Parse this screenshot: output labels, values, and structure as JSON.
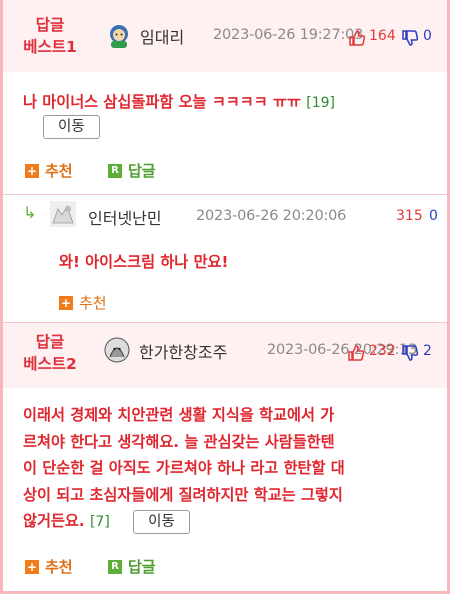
{
  "comments": [
    {
      "badge": "답글\n베스트1",
      "badge_line1": "답글",
      "badge_line2": "베스트1",
      "author": "임대리",
      "date": "2023-06-26 19:27:03",
      "upvotes": "164",
      "downvotes": "0",
      "text": "나 마이너스 삼십돌파함 오늘 ㅋㅋㅋㅋ ㅠㅠ",
      "reply_count": "[19]",
      "move_label": "이동",
      "recommend_label": "추천",
      "reply_label": "답글"
    },
    {
      "author": "인터넷난민",
      "date": "2023-06-26 20:20:06",
      "upvotes": "315",
      "downvotes": "0",
      "text": "와! 아이스크림 하나 만요!",
      "recommend_label": "추천"
    },
    {
      "badge_line1": "답글",
      "badge_line2": "베스트2",
      "author": "한가한창조주",
      "date": "2023-06-26 20:29:13",
      "upvotes": "232",
      "downvotes": "2",
      "text_line1": "이래서 경제와 치안관련 생활 지식을 학교에서 가",
      "text_line2": "르쳐야 한다고 생각해요. 늘 관심갖는 사람들한텐",
      "text_line3": "이 단순한 걸 아직도 가르쳐야 하나 라고 한탄할 대",
      "text_line4": "상이 되고 초심자들에게 질려하지만 학교는 그렇지",
      "text_line5": "않거든요.",
      "reply_count": "[7]",
      "move_label": "이동",
      "recommend_label": "추천",
      "reply_label": "답글"
    }
  ],
  "icons": {
    "thumb_up": "thumb-up-icon",
    "thumb_down": "thumb-down-icon",
    "plus": "plus-icon",
    "reply": "reply-icon"
  },
  "colors": {
    "best_bg": "#fff0f1",
    "best_text": "#e0303e",
    "border": "#f7b7bd",
    "upvote": "#e03a3a",
    "downvote": "#2c3ec0",
    "recommend": "#e07016",
    "reply": "#4f9d2e"
  }
}
